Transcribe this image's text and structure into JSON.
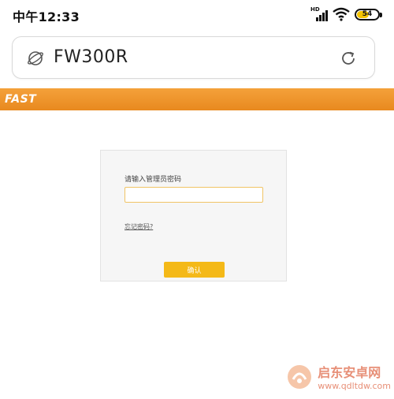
{
  "status_bar": {
    "time": "中午12:33",
    "network_label": "HD",
    "battery_level": "54",
    "battery_fraction": 0.54,
    "icons": [
      "signal-icon",
      "wifi-icon",
      "battery-icon"
    ]
  },
  "address_bar": {
    "url": "FW300R",
    "left_icon": "globe-icon",
    "right_icon": "refresh-icon"
  },
  "brand": {
    "logo_text": "FAST",
    "color": "#eb9125"
  },
  "login": {
    "password_label": "请输入管理员密码",
    "password_value": "",
    "forgot_link": "忘记密码?",
    "confirm_label": "确认",
    "input_border_color": "#f0c465",
    "button_color": "#f4b918"
  },
  "watermark": {
    "title": "启东安卓网",
    "url": "www.qdltdw.com"
  }
}
